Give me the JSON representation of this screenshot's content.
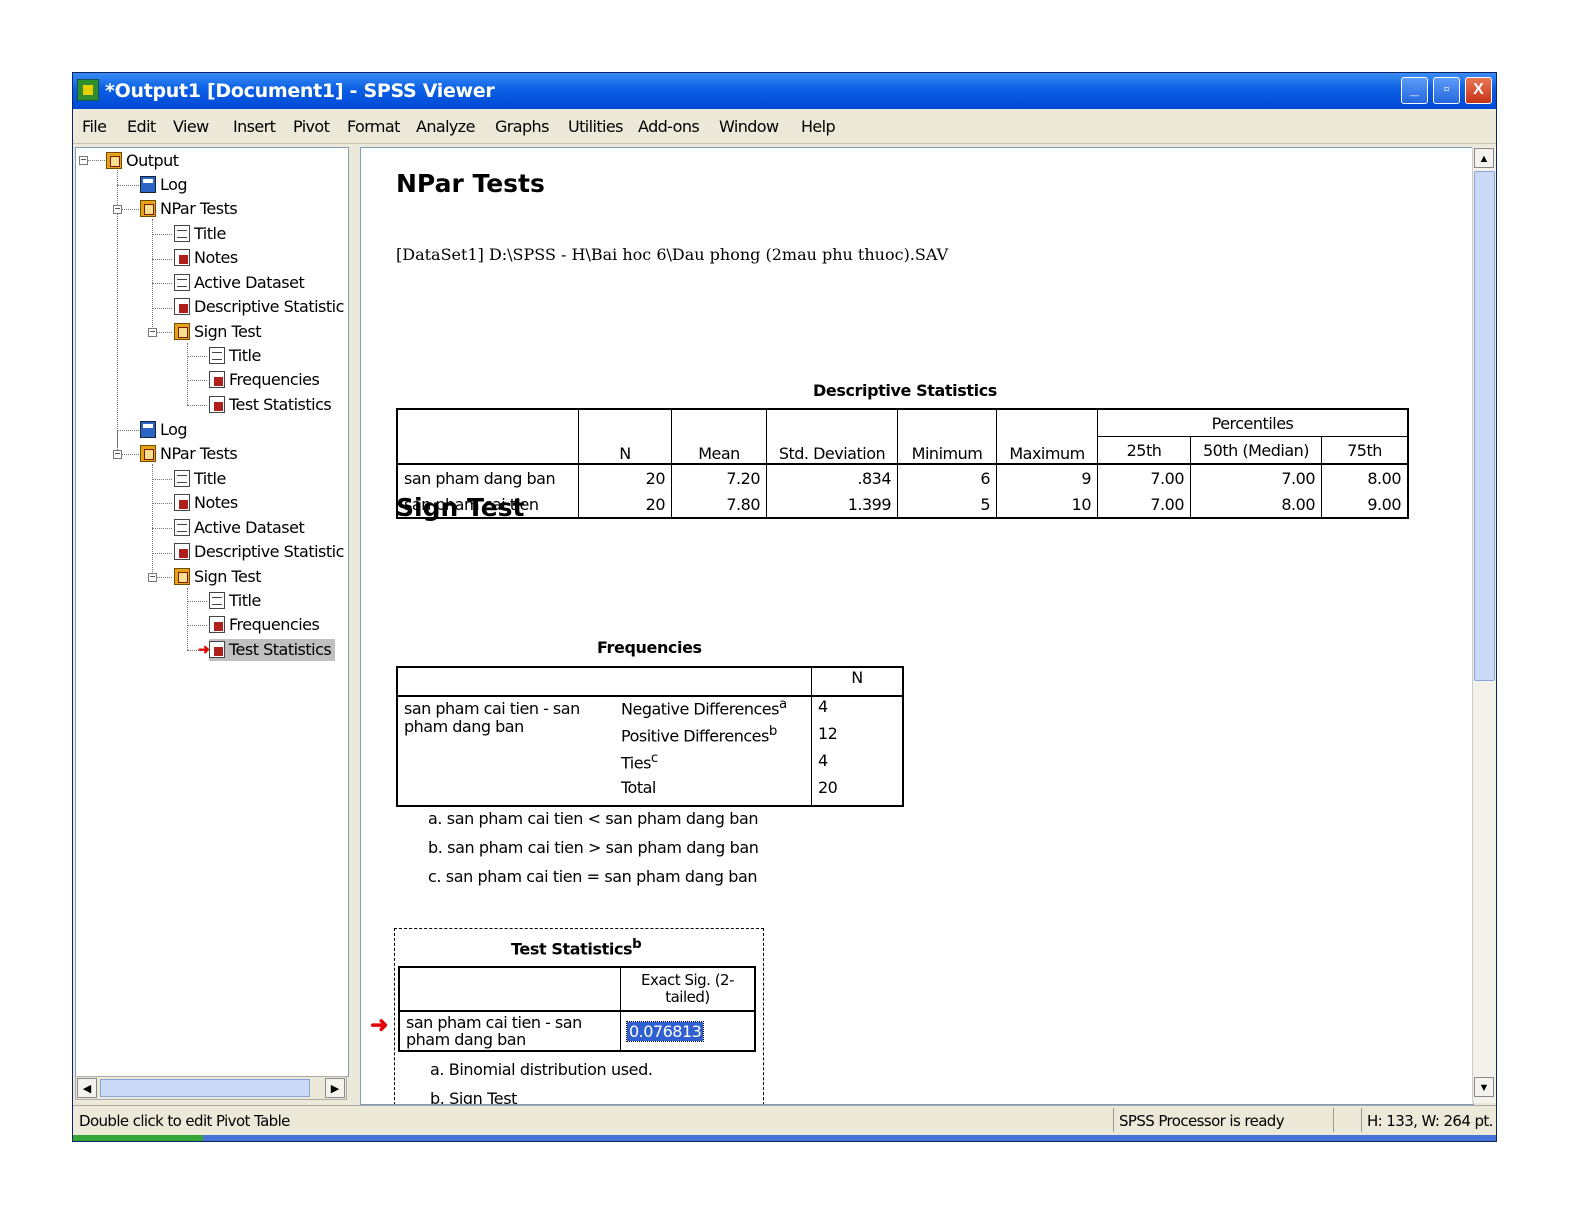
{
  "window": {
    "title": "*Output1 [Document1] - SPSS Viewer",
    "controls": {
      "minimize": "_",
      "restore": "▫",
      "close": "X"
    }
  },
  "menu": [
    "File",
    "Edit",
    "View",
    "Insert",
    "Pivot",
    "Format",
    "Analyze",
    "Graphs",
    "Utilities",
    "Add-ons",
    "Window",
    "Help"
  ],
  "tree": {
    "root": "Output",
    "nodes": [
      "Log",
      "NPar Tests",
      "Title",
      "Notes",
      "Active Dataset",
      "Descriptive Statistic",
      "Sign Test",
      "Title",
      "Frequencies",
      "Test Statistics",
      "Log",
      "NPar Tests",
      "Title",
      "Notes",
      "Active Dataset",
      "Descriptive Statistic",
      "Sign Test",
      "Title",
      "Frequencies",
      "Test Statistics"
    ],
    "selected": "Test Statistics"
  },
  "content": {
    "heading1": "NPar  Tests",
    "dataset": "[DataSet1] D:\\SPSS - H\\Bai hoc 6\\Dau phong (2mau phu thuoc).SAV",
    "desc_caption": "Descriptive Statistics",
    "desc_headers": {
      "percentiles": "Percentiles",
      "n": "N",
      "mean": "Mean",
      "sd": "Std. Deviation",
      "min": "Minimum",
      "max": "Maximum",
      "p25": "25th",
      "p50": "50th (Median)",
      "p75": "75th"
    },
    "desc_rows": [
      {
        "name": "san pham dang ban",
        "n": "20",
        "mean": "7.20",
        "sd": ".834",
        "min": "6",
        "max": "9",
        "p25": "7.00",
        "p50": "7.00",
        "p75": "8.00"
      },
      {
        "name": "san pham cai tien",
        "n": "20",
        "mean": "7.80",
        "sd": "1.399",
        "min": "5",
        "max": "10",
        "p25": "7.00",
        "p50": "8.00",
        "p75": "9.00"
      }
    ],
    "heading2": "Sign  Test",
    "freq_caption": "Frequencies",
    "freq_header_n": "N",
    "freq_row_label": "san pham cai tien - san pham dang ban",
    "freq_rows": [
      {
        "label": "Negative Differences",
        "sup": "a",
        "n": "4"
      },
      {
        "label": "Positive Differences",
        "sup": "b",
        "n": "12"
      },
      {
        "label": "Ties",
        "sup": "c",
        "n": "4"
      },
      {
        "label": "Total",
        "sup": "",
        "n": "20"
      }
    ],
    "freq_footnotes": [
      "a. san pham cai tien < san pham dang ban",
      "b. san pham cai tien > san pham dang ban",
      "c. san pham cai tien = san pham dang ban"
    ],
    "ts_caption": "Test Statistics",
    "ts_caption_sup": "b",
    "ts_header": "Exact Sig. (2-tailed)",
    "ts_row_label": "san pham cai tien - san pham dang ban",
    "ts_value": "0.076813",
    "ts_footnotes": [
      "a. Binomial distribution used.",
      "b. Sign Test"
    ]
  },
  "status": {
    "left": "Double click to edit Pivot Table",
    "processor": "SPSS  Processor is ready",
    "dims": "H: 133, W: 264 pt."
  }
}
